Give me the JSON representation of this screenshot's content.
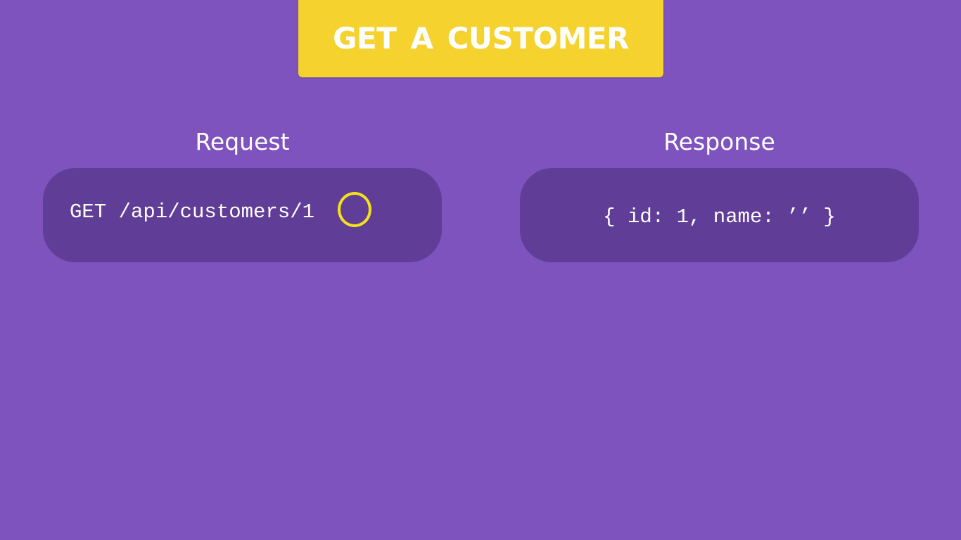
{
  "title": "GET  A CUSTOMER",
  "request": {
    "heading": "Request",
    "code": "GET /api/customers/1"
  },
  "response": {
    "heading": "Response",
    "code": "{ id: 1, name: ’’ }"
  },
  "colors": {
    "background": "#7e53bd",
    "banner": "#f5d22e",
    "panel": "#603d97",
    "highlight": "#f2e21a",
    "text": "#ffffff"
  }
}
